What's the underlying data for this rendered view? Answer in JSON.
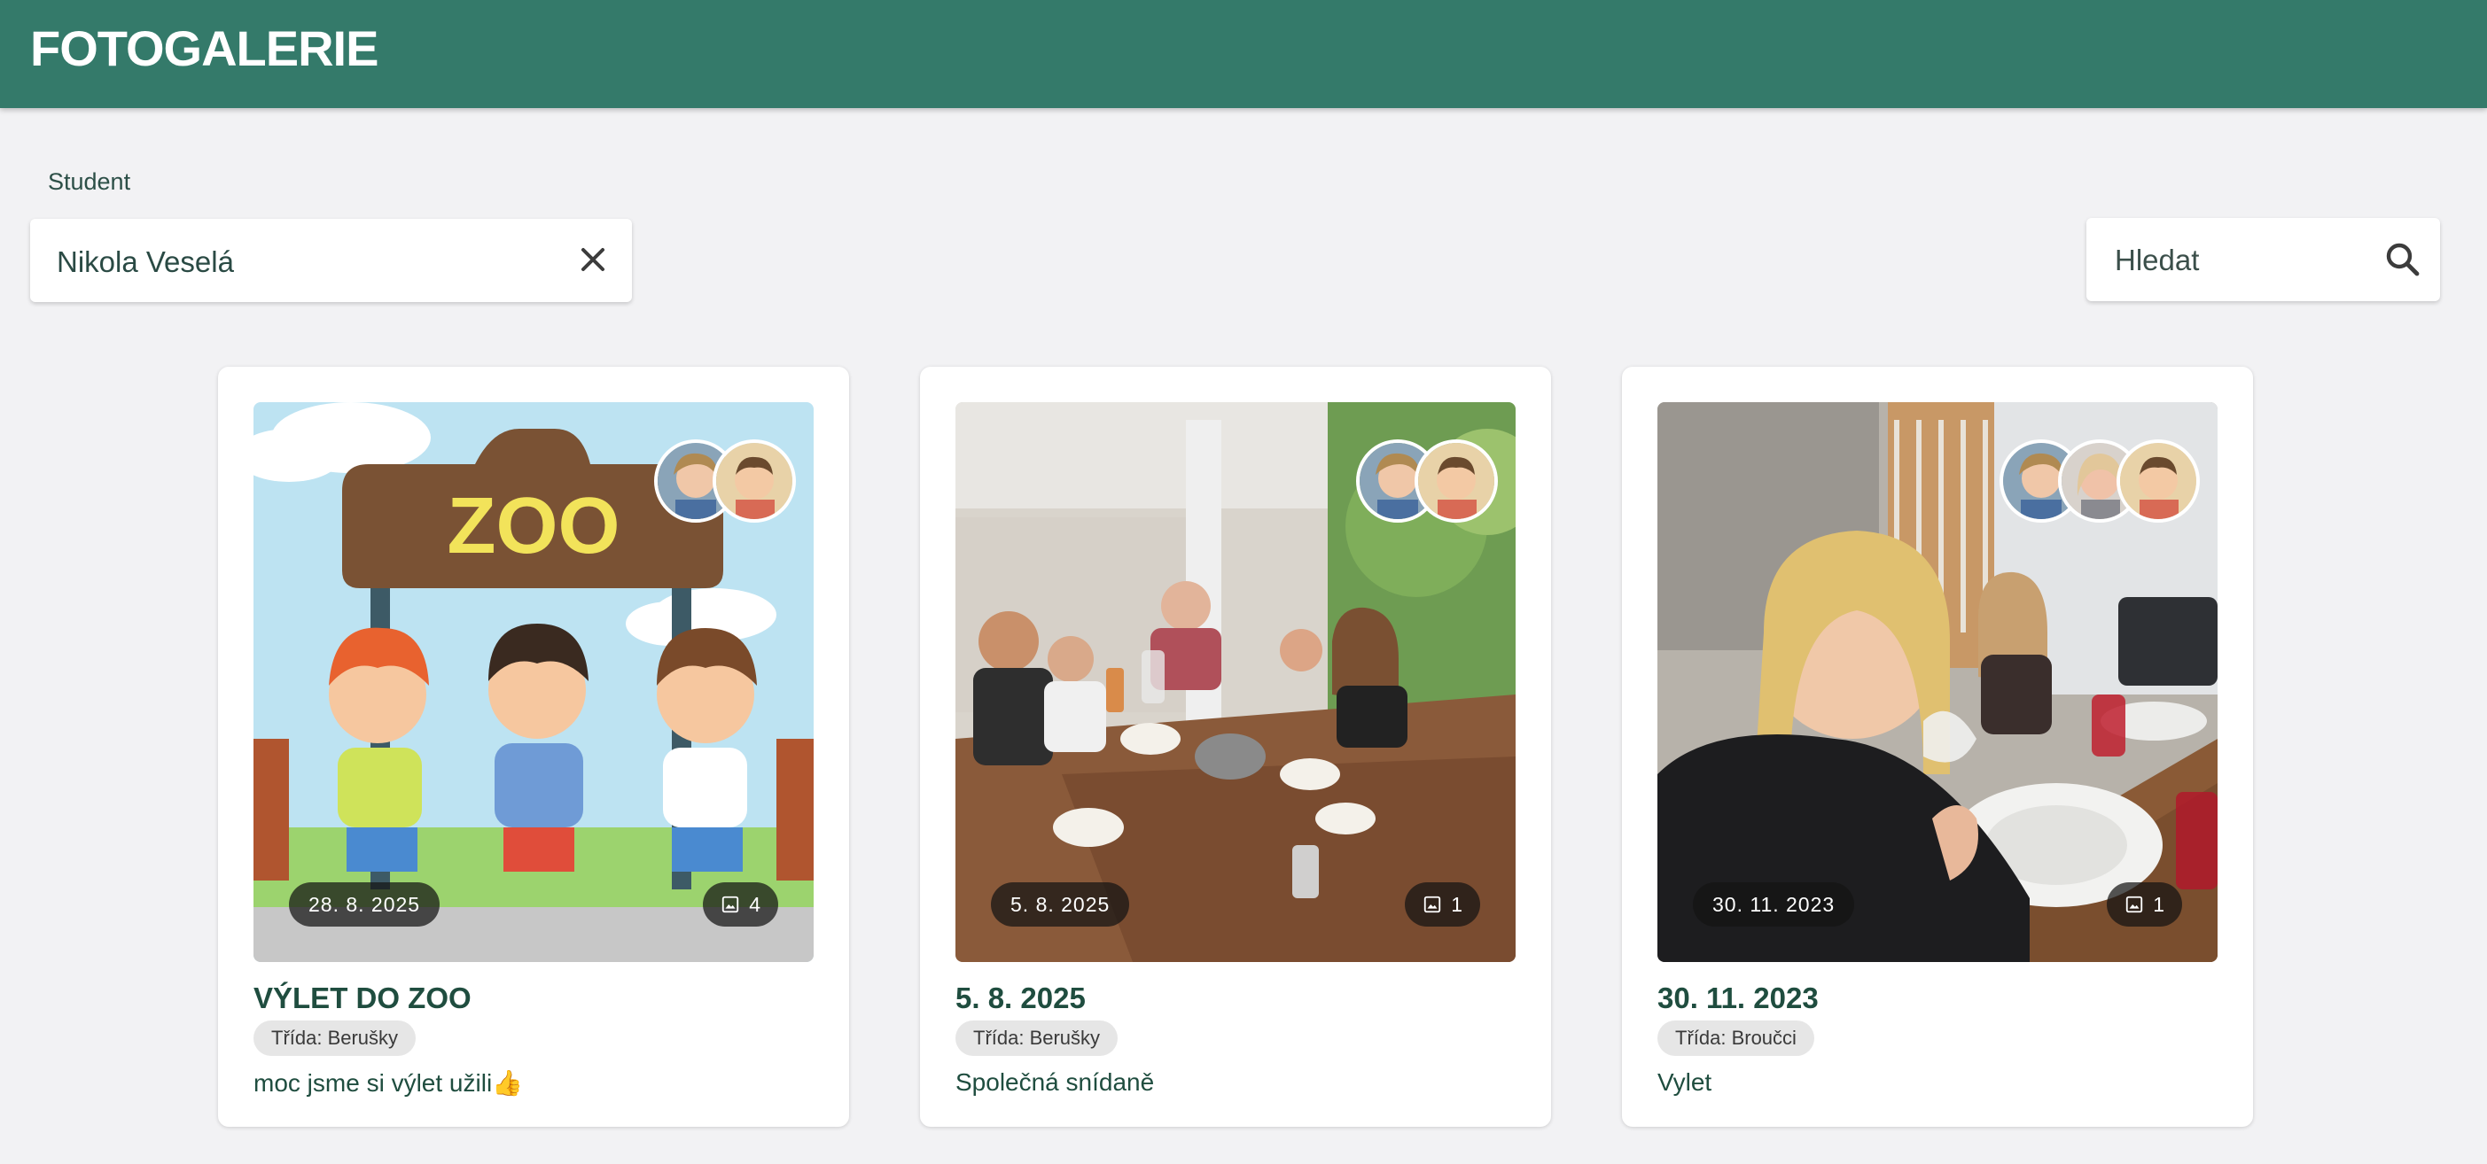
{
  "app": {
    "title": "FOTOGALERIE"
  },
  "filter": {
    "student_label": "Student",
    "student_value": "Nikola Veselá",
    "search_placeholder": "Hledat"
  },
  "albums": [
    {
      "title": "VÝLET DO ZOO",
      "date": "28. 8. 2025",
      "photo_count": "4",
      "class_chip": "Třída: Berušky",
      "caption": "moc jsme si výlet užili👍",
      "avatar_count": 2
    },
    {
      "title": "5. 8. 2025",
      "date": "5. 8. 2025",
      "photo_count": "1",
      "class_chip": "Třída: Berušky",
      "caption": "Společná snídaně",
      "avatar_count": 2
    },
    {
      "title": "30. 11. 2023",
      "date": "30. 11. 2023",
      "photo_count": "1",
      "class_chip": "Třída: Broučci",
      "caption": "Vylet",
      "avatar_count": 3
    }
  ],
  "colors": {
    "appbar": "#347a6a",
    "accent_text": "#1f4d3f",
    "background": "#f2f2f4"
  },
  "icons": {
    "clear": "close-icon",
    "search": "search-icon",
    "photo_count": "image-icon"
  }
}
